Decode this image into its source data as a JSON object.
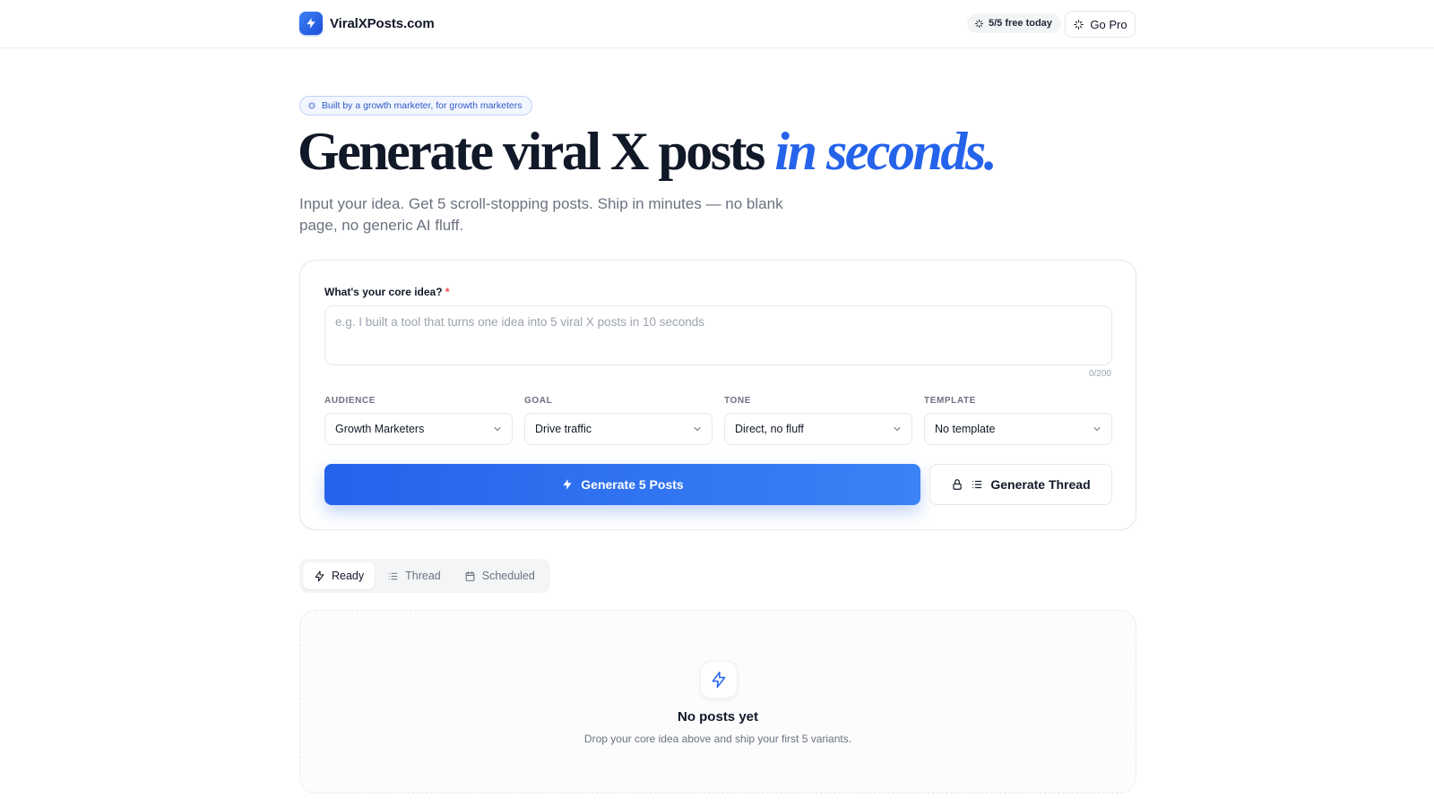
{
  "header": {
    "brand_name": "ViralXPosts.com",
    "free_usage": "5/5 free today",
    "go_pro_label": "Go Pro"
  },
  "hero": {
    "badge": "Built by a growth marketer, for growth marketers",
    "headline_main": "Generate viral X posts ",
    "headline_accent": "in seconds.",
    "subhead": "Input your idea. Get 5 scroll-stopping posts. Ship in minutes — no blank page, no generic AI fluff."
  },
  "form": {
    "idea_label": "What's your core idea?",
    "required_mark": "*",
    "idea_value": "",
    "idea_placeholder": "e.g. I built a tool that turns one idea into 5 viral X posts in 10 seconds",
    "char_counter": "0/200",
    "selects": [
      {
        "label": "AUDIENCE",
        "value": "Growth Marketers"
      },
      {
        "label": "GOAL",
        "value": "Drive traffic"
      },
      {
        "label": "TONE",
        "value": "Direct, no fluff"
      },
      {
        "label": "TEMPLATE",
        "value": "No template"
      }
    ],
    "generate_label": "Generate 5 Posts",
    "thread_label": "Generate Thread"
  },
  "tabs": [
    {
      "label": "Ready",
      "icon": "bolt-icon",
      "active": true
    },
    {
      "label": "Thread",
      "icon": "list-icon",
      "active": false
    },
    {
      "label": "Scheduled",
      "icon": "calendar-icon",
      "active": false
    }
  ],
  "empty_state": {
    "title": "No posts yet",
    "subtitle": "Drop your core idea above and ship your first 5 variants."
  },
  "colors": {
    "accent": "#2563eb",
    "text": "#111827",
    "muted": "#6b7280",
    "required": "#ef4444"
  }
}
